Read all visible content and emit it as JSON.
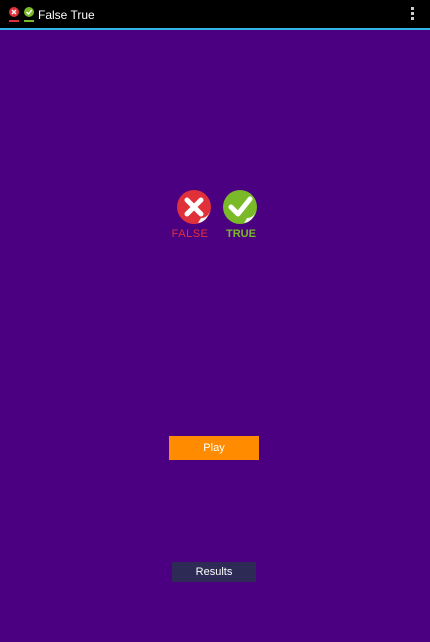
{
  "app": {
    "title": "False True",
    "background_color": "#4b0082"
  },
  "action_bar": {
    "background_color": "#000000",
    "accent_color": "#33b5e5",
    "icon": "false-true-app-icon",
    "overflow_icon": "overflow-menu-icon"
  },
  "logo": {
    "false_label": "FALSE",
    "true_label": "TRUE",
    "false_icon": "red-x-icon",
    "true_icon": "green-check-icon",
    "false_color": "#e0313a",
    "true_color": "#7ab928"
  },
  "buttons": {
    "play_label": "Play",
    "play_color": "#ff8c00",
    "results_label": "Results",
    "results_color": "#2e2a56"
  }
}
